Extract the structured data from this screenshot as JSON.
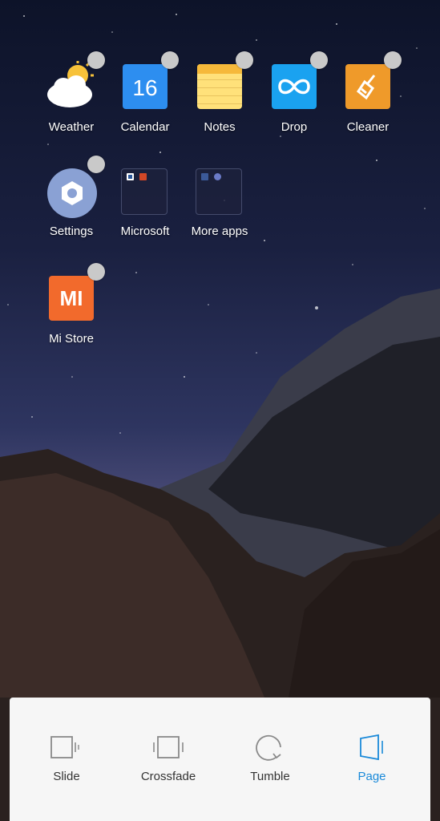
{
  "home_screen": {
    "apps": [
      {
        "label": "Weather",
        "icon": "weather-icon"
      },
      {
        "label": "Calendar",
        "icon": "calendar-icon",
        "date_number": "16"
      },
      {
        "label": "Notes",
        "icon": "notes-icon"
      },
      {
        "label": "Drop",
        "icon": "drop-icon"
      },
      {
        "label": "Cleaner",
        "icon": "cleaner-icon"
      },
      {
        "label": "Settings",
        "icon": "gear-icon"
      },
      {
        "label": "Microsoft",
        "icon": "folder-icon"
      },
      {
        "label": "More apps",
        "icon": "folder-icon"
      },
      {
        "label": "Mi Store",
        "icon": "mi-store-icon",
        "logo_text": "MI"
      }
    ]
  },
  "transition_panel": {
    "options": [
      {
        "label": "Slide",
        "selected": false
      },
      {
        "label": "Crossfade",
        "selected": false
      },
      {
        "label": "Tumble",
        "selected": false
      },
      {
        "label": "Page",
        "selected": true
      }
    ],
    "accent_color": "#1b8ad9"
  }
}
